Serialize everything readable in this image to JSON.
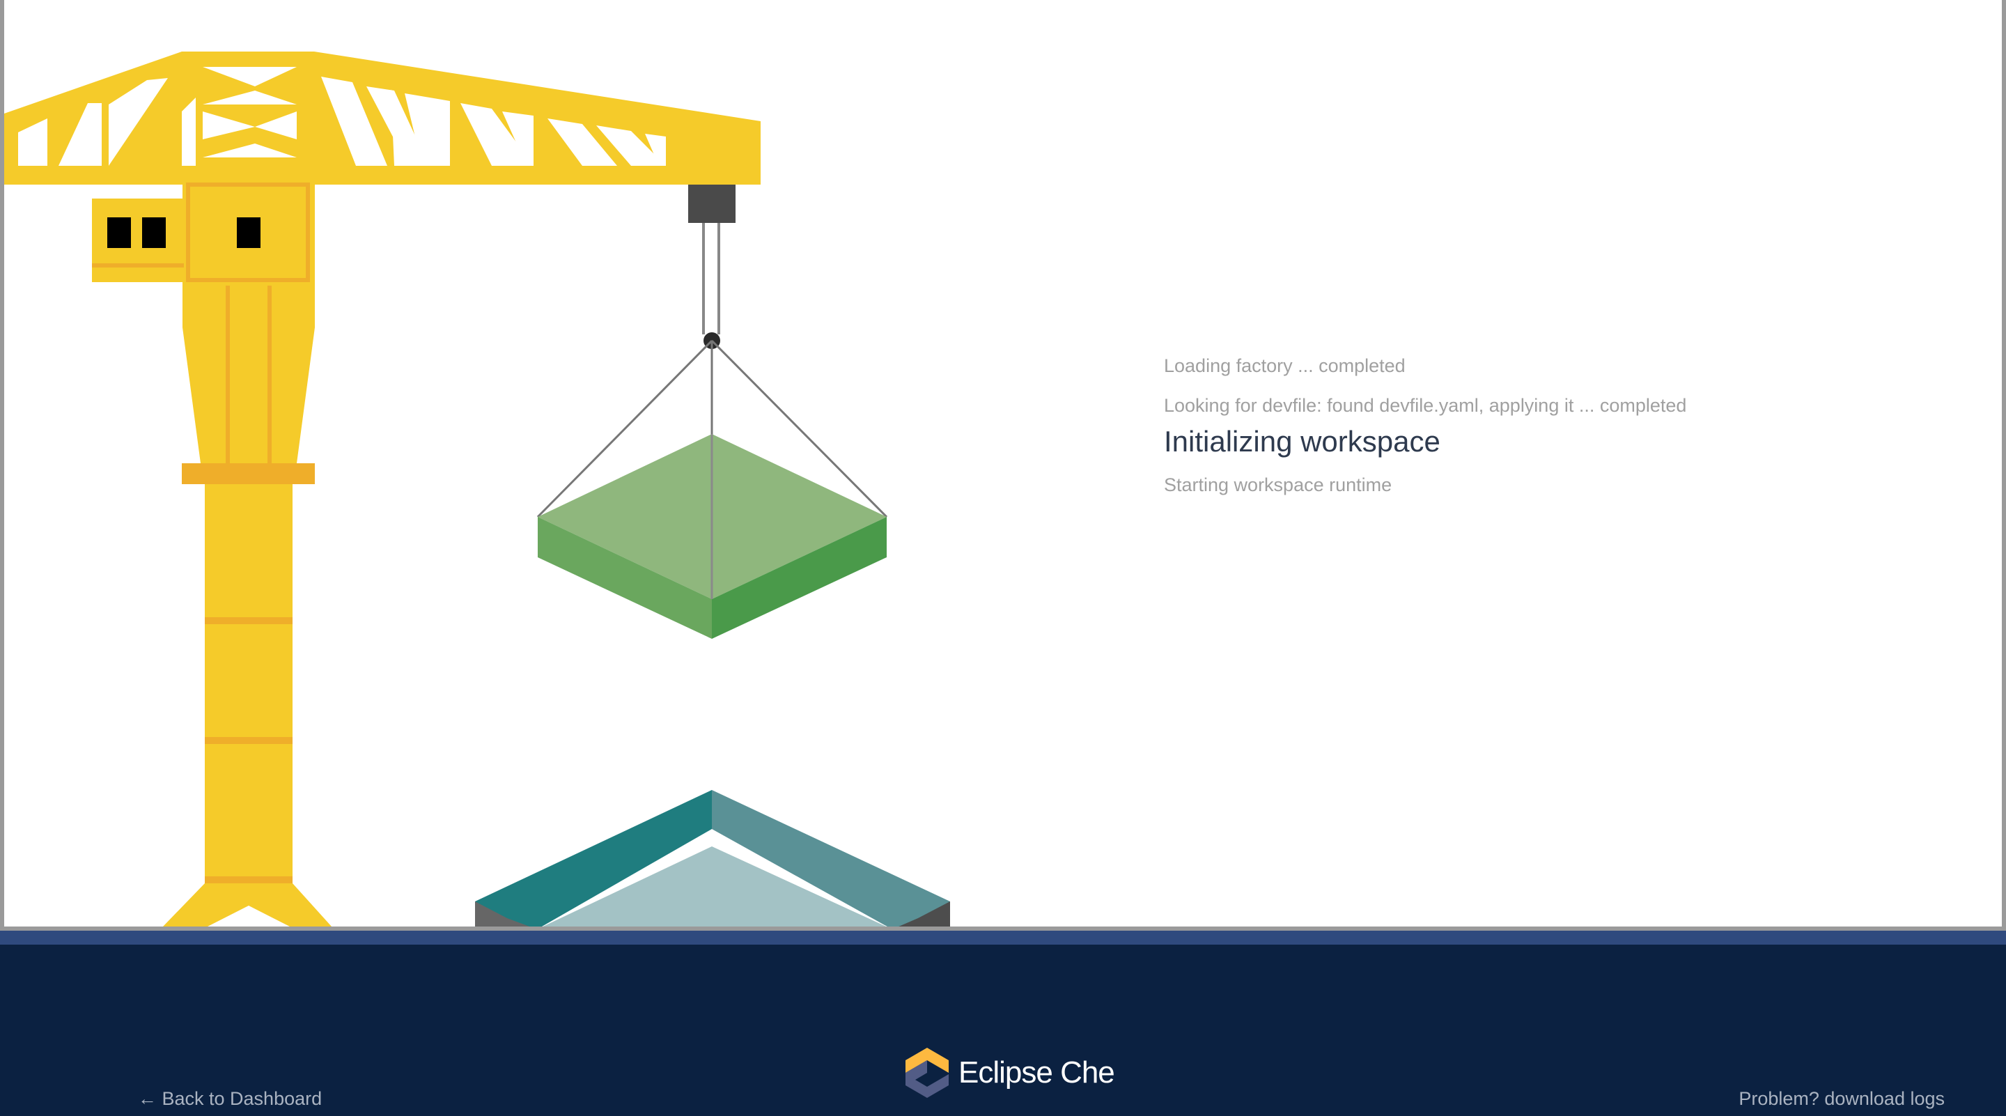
{
  "progress": {
    "steps": [
      {
        "text": "Loading factory ... completed",
        "state": "completed"
      },
      {
        "text": "Looking for devfile: found devfile.yaml, applying it ... completed",
        "state": "completed"
      },
      {
        "text": "Initializing workspace",
        "state": "current"
      },
      {
        "text": "Starting workspace runtime",
        "state": "pending"
      }
    ]
  },
  "footer": {
    "back_label": "← Back to Dashboard",
    "logs_label": "Problem? download logs",
    "brand_name": "Eclipse Che"
  },
  "colors": {
    "crane_yellow": "#f5cb2a",
    "crane_orange": "#efae2a",
    "cargo_green": "#8fb77d",
    "container_teal": "#1f7d7f",
    "footer_bg": "#0b2141",
    "band_blue": "#2f4a7e",
    "brand_yellow": "#fdb940",
    "brand_indigo": "#525c86"
  },
  "icons": {
    "crane": "crane-illustration",
    "cargo": "cargo-block",
    "container": "container-base",
    "logo": "eclipse-che-logo"
  }
}
